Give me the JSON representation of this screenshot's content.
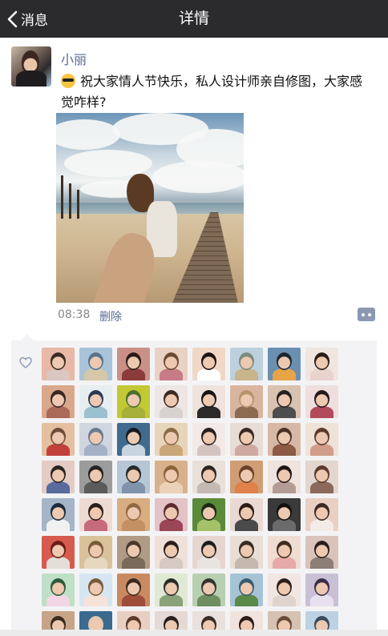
{
  "nav": {
    "back_label": "消息",
    "title": "详情",
    "bar_color": "#2b2b2e"
  },
  "post": {
    "username": "小丽",
    "text": "祝大家情人节快乐，私人设计师亲自修图，大家感觉咋样?",
    "emoji_icon": "sunglasses-emoji",
    "time": "08:38",
    "delete_label": "删除",
    "link_color": "#576b95"
  },
  "likes": {
    "icon": "heart-outline-icon",
    "liker_count": 64,
    "palette": [
      [
        "#e7b9a6",
        "#3a2a22",
        "#d9c7c0"
      ],
      [
        "#a9c3d8",
        "#56738c",
        "#d5c7a8"
      ],
      [
        "#c99186",
        "#2a1a16",
        "#8b3c3a"
      ],
      [
        "#e9d2c3",
        "#6b4a33",
        "#c77b86"
      ],
      [
        "#f0d7c6",
        "#1c1414",
        "#ffffff"
      ],
      [
        "#bcd0dd",
        "#7a8b7a",
        "#c8b58c"
      ],
      [
        "#6b8fb0",
        "#1c2631",
        "#e6a447"
      ],
      [
        "#f1e5df",
        "#2a1b18",
        "#e8d3cd"
      ],
      [
        "#d9a78c",
        "#3b2621",
        "#aa6a57"
      ],
      [
        "#e7eef2",
        "#2b3a52",
        "#9bc0cf"
      ],
      [
        "#c2c935",
        "#4f6f2c",
        "#a6b03b"
      ],
      [
        "#ede6e4",
        "#3a2a23",
        "#d8d2cf"
      ],
      [
        "#f0e2dc",
        "#141414",
        "#2a2a2a"
      ],
      [
        "#d9b59f",
        "#b7936e",
        "#8d6b53"
      ],
      [
        "#d9c2b0",
        "#222222",
        "#4d4d4d"
      ],
      [
        "#eedede",
        "#241a1a",
        "#b24a5b"
      ],
      [
        "#e4c0a0",
        "#6f4b3a",
        "#c2403b"
      ],
      [
        "#cfd6df",
        "#6c7a8f",
        "#a4b1c6"
      ],
      [
        "#3f6b8e",
        "#161b22",
        "#c8d4df"
      ],
      [
        "#e7d5b9",
        "#8a6a46",
        "#c9a779"
      ],
      [
        "#f3e9e6",
        "#2b1f1d",
        "#d4c4c0"
      ],
      [
        "#e8dcd6",
        "#3a2a23",
        "#cfa9a1"
      ],
      [
        "#d7b8a5",
        "#4b3125",
        "#8c5a45"
      ],
      [
        "#efe2d7",
        "#5a3b2a",
        "#d09d8a"
      ],
      [
        "#e4ccc4",
        "#2b2424",
        "#586b9c"
      ],
      [
        "#9c9c9c",
        "#232323",
        "#5b5b5b"
      ],
      [
        "#b7c6d6",
        "#2a2a2a",
        "#7f93aa"
      ],
      [
        "#d9b08c",
        "#8c6239",
        "#ead1b7"
      ],
      [
        "#e9e0da",
        "#2e2523",
        "#c5b9b4"
      ],
      [
        "#cf9e75",
        "#6a4128",
        "#e0814a"
      ],
      [
        "#efe3dd",
        "#1d1616",
        "#b49b94"
      ],
      [
        "#e3d6cf",
        "#5c3a2e",
        "#8b6a5c"
      ],
      [
        "#a5b4c6",
        "#1a2a3b",
        "#f1f1f1"
      ],
      [
        "#eddad1",
        "#2c1e1a",
        "#c76a7a"
      ],
      [
        "#d8ad80",
        "#8f6b43",
        "#c29063"
      ],
      [
        "#e3c3c7",
        "#5d2a30",
        "#9b4656"
      ],
      [
        "#5a8a3a",
        "#1a2a13",
        "#a3c26a"
      ],
      [
        "#ead9d2",
        "#2b1c18",
        "#4a4a4a"
      ],
      [
        "#3a3a3a",
        "#111111",
        "#6b6b6b"
      ],
      [
        "#e9d0c2",
        "#3a2a22",
        "#f3ebe7"
      ],
      [
        "#d65a4e",
        "#6b1c18",
        "#e3ddd8"
      ],
      [
        "#d9c29a",
        "#7a5b3b",
        "#e6d8bf"
      ],
      [
        "#b09b84",
        "#4a3a2c",
        "#7a6a5a"
      ],
      [
        "#efe0da",
        "#2a1d1a",
        "#d6c8c2"
      ],
      [
        "#e7d5cf",
        "#1d1d1d",
        "#eae4e1"
      ],
      [
        "#e9ded6",
        "#3b2c23",
        "#c5b8ae"
      ],
      [
        "#efdcd3",
        "#412b20",
        "#e7a9a9"
      ],
      [
        "#d9c3bb",
        "#2a1e1b",
        "#8d7d77"
      ],
      [
        "#bfe0c6",
        "#2f5a3c",
        "#f3d6e3"
      ],
      [
        "#d5e6f2",
        "#7a5b3b",
        "#f5e3d9"
      ],
      [
        "#c98a62",
        "#3b2a20",
        "#9e4d3b"
      ],
      [
        "#dfe9d4",
        "#2a2a2a",
        "#8aa27a"
      ],
      [
        "#b8d0b0",
        "#333333",
        "#6f8f62"
      ],
      [
        "#a6c3d6",
        "#3a5a6e",
        "#5a8a4a"
      ],
      [
        "#f1e6e2",
        "#2b201d",
        "#e0d4cf"
      ],
      [
        "#c9c0d6",
        "#3b2c4a",
        "#e7e0ee"
      ],
      [
        "#c7a488",
        "#3b2a1e",
        "#8a6a55"
      ],
      [
        "#3b6a8e",
        "#e7c9b0",
        "#ffffff"
      ],
      [
        "#e9cfc2",
        "#5b3a2a",
        "#a06c5a"
      ],
      [
        "#e4d9d4",
        "#2a1e1a",
        "#bcb0ab"
      ],
      [
        "#eae1dc",
        "#3b2b25",
        "#cfc2bb"
      ],
      [
        "#f0e3dd",
        "#2b1c18",
        "#e8dcd6"
      ],
      [
        "#d5c2b3",
        "#6a4a38",
        "#a78d7a"
      ],
      [
        "#bcd2e3",
        "#3a4b5c",
        "#8fb0c8"
      ]
    ]
  }
}
